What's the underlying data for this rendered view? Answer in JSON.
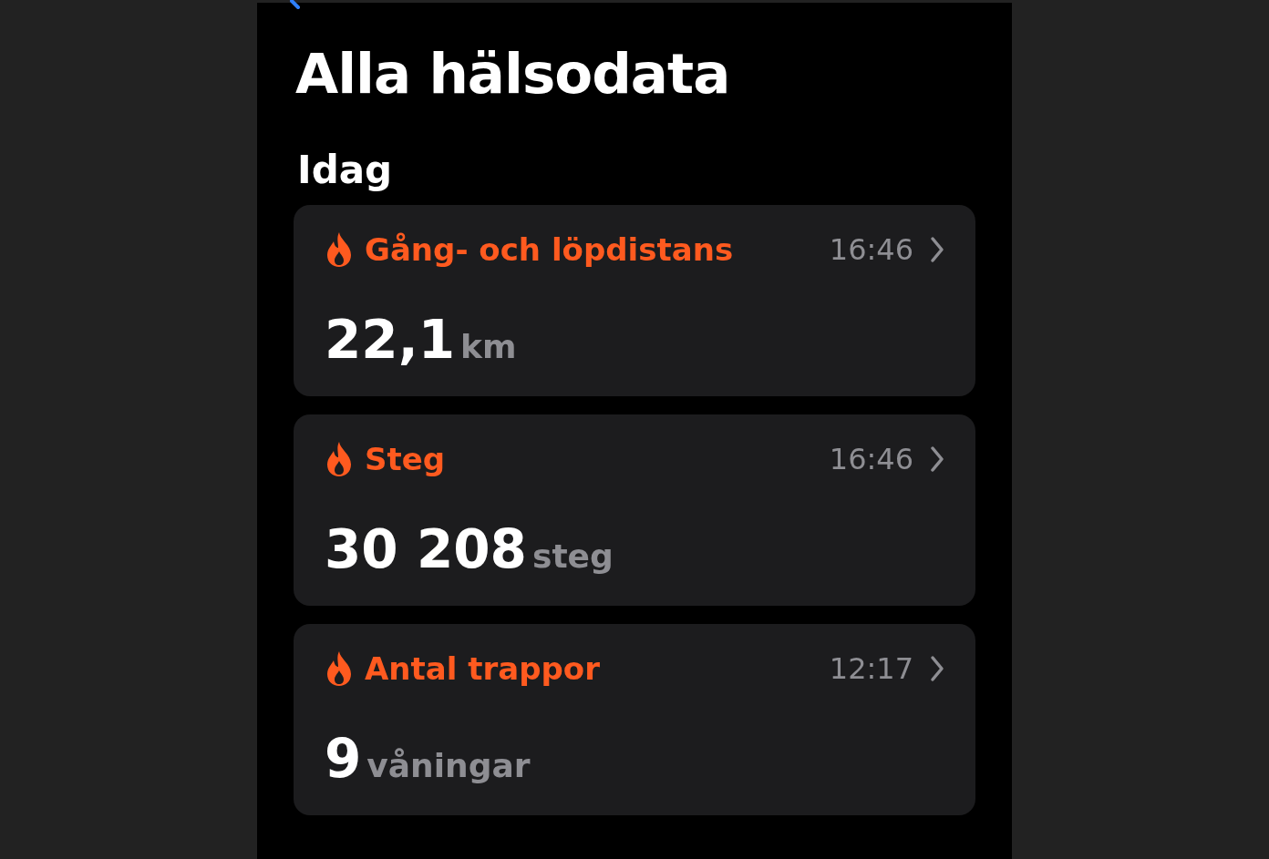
{
  "title": "Alla hälsodata",
  "section": "Idag",
  "cards": [
    {
      "label": "Gång- och löpdistans",
      "time": "16:46",
      "value": "22,1",
      "unit": "km"
    },
    {
      "label": "Steg",
      "time": "16:46",
      "value": "30 208",
      "unit": "steg"
    },
    {
      "label": "Antal trappor",
      "time": "12:17",
      "value": "9",
      "unit": "våningar"
    }
  ]
}
